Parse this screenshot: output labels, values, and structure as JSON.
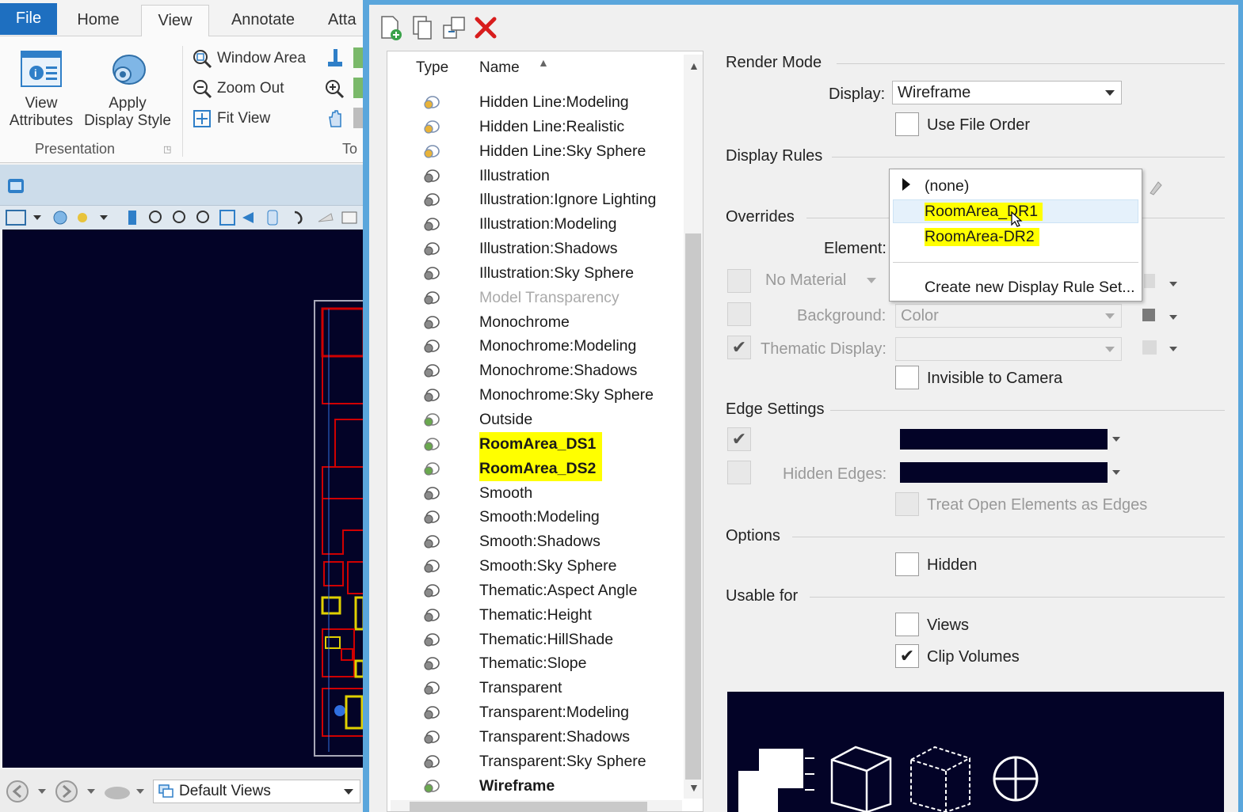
{
  "ribbon": {
    "tabs": [
      "File",
      "Home",
      "View",
      "Annotate",
      "Atta"
    ],
    "buttons": {
      "view_attributes": "View\nAttributes",
      "apply_display_style": "Apply\nDisplay Style",
      "window_area": "Window Area",
      "zoom_out": "Zoom Out",
      "fit_view": "Fit View"
    },
    "group_presentation": "Presentation",
    "group_tools": "To"
  },
  "status": {
    "views_combo": "Default Views"
  },
  "list": {
    "col_type": "Type",
    "col_name": "Name",
    "items": [
      {
        "name": "Hidden Line:Modeling",
        "icon": "style-icon-gold",
        "state": "normal"
      },
      {
        "name": "Hidden Line:Realistic",
        "icon": "style-icon-gold",
        "state": "normal"
      },
      {
        "name": "Hidden Line:Sky Sphere",
        "icon": "style-icon-gold",
        "state": "normal"
      },
      {
        "name": "Illustration",
        "icon": "style-icon-gray",
        "state": "normal"
      },
      {
        "name": "Illustration:Ignore Lighting",
        "icon": "style-icon-gray",
        "state": "normal"
      },
      {
        "name": "Illustration:Modeling",
        "icon": "style-icon-gray",
        "state": "normal"
      },
      {
        "name": "Illustration:Shadows",
        "icon": "style-icon-gray",
        "state": "normal"
      },
      {
        "name": "Illustration:Sky Sphere",
        "icon": "style-icon-gray",
        "state": "normal"
      },
      {
        "name": "Model Transparency",
        "icon": "style-icon-gray",
        "state": "disabled"
      },
      {
        "name": "Monochrome",
        "icon": "style-icon-gray",
        "state": "normal"
      },
      {
        "name": "Monochrome:Modeling",
        "icon": "style-icon-gray",
        "state": "normal"
      },
      {
        "name": "Monochrome:Shadows",
        "icon": "style-icon-gray",
        "state": "normal"
      },
      {
        "name": "Monochrome:Sky Sphere",
        "icon": "style-icon-gray",
        "state": "normal"
      },
      {
        "name": "Outside",
        "icon": "style-icon-green",
        "state": "normal"
      },
      {
        "name": "RoomArea_DS1",
        "icon": "style-icon-green",
        "state": "highlight"
      },
      {
        "name": "RoomArea_DS2",
        "icon": "style-icon-green",
        "state": "highlight"
      },
      {
        "name": "Smooth",
        "icon": "style-icon-gray",
        "state": "normal"
      },
      {
        "name": "Smooth:Modeling",
        "icon": "style-icon-gray",
        "state": "normal"
      },
      {
        "name": "Smooth:Shadows",
        "icon": "style-icon-gray",
        "state": "normal"
      },
      {
        "name": "Smooth:Sky Sphere",
        "icon": "style-icon-gray",
        "state": "normal"
      },
      {
        "name": "Thematic:Aspect Angle",
        "icon": "style-icon-gray",
        "state": "normal"
      },
      {
        "name": "Thematic:Height",
        "icon": "style-icon-gray",
        "state": "normal"
      },
      {
        "name": "Thematic:HillShade",
        "icon": "style-icon-gray",
        "state": "normal"
      },
      {
        "name": "Thematic:Slope",
        "icon": "style-icon-gray",
        "state": "normal"
      },
      {
        "name": "Transparent",
        "icon": "style-icon-gray",
        "state": "normal"
      },
      {
        "name": "Transparent:Modeling",
        "icon": "style-icon-gray",
        "state": "normal"
      },
      {
        "name": "Transparent:Shadows",
        "icon": "style-icon-gray",
        "state": "normal"
      },
      {
        "name": "Transparent:Sky Sphere",
        "icon": "style-icon-gray",
        "state": "normal"
      },
      {
        "name": "Wireframe",
        "icon": "style-icon-green",
        "state": "bold"
      }
    ]
  },
  "render_mode": {
    "title": "Render Mode",
    "display_label": "Display:",
    "display_value": "Wireframe",
    "use_file_order": "Use File Order"
  },
  "display_rules": {
    "title": "Display Rules",
    "popup_items": [
      "(none)",
      "RoomArea_DR1",
      "RoomArea-DR2",
      "Create new Display Rule Set..."
    ]
  },
  "overrides": {
    "title": "Overrides",
    "element_label": "Element:",
    "material_value": "No Material",
    "background_label": "Background:",
    "background_value": "Color",
    "thematic_label": "Thematic Display:",
    "invisible_camera": "Invisible to Camera"
  },
  "edge_settings": {
    "title": "Edge Settings",
    "hidden_edges_label": "Hidden Edges:",
    "treat_open": "Treat Open Elements as Edges"
  },
  "options": {
    "title": "Options",
    "hidden": "Hidden"
  },
  "usable_for": {
    "title": "Usable for",
    "views": "Views",
    "clip_volumes": "Clip Volumes"
  },
  "colors": {
    "viewport_bg": "#030327",
    "highlight": "#ffff00",
    "file_tab": "#1e6fc0",
    "dialog_frame": "#5aa6dc",
    "drawing_red": "#d00000",
    "drawing_yellow": "#e0d000"
  }
}
